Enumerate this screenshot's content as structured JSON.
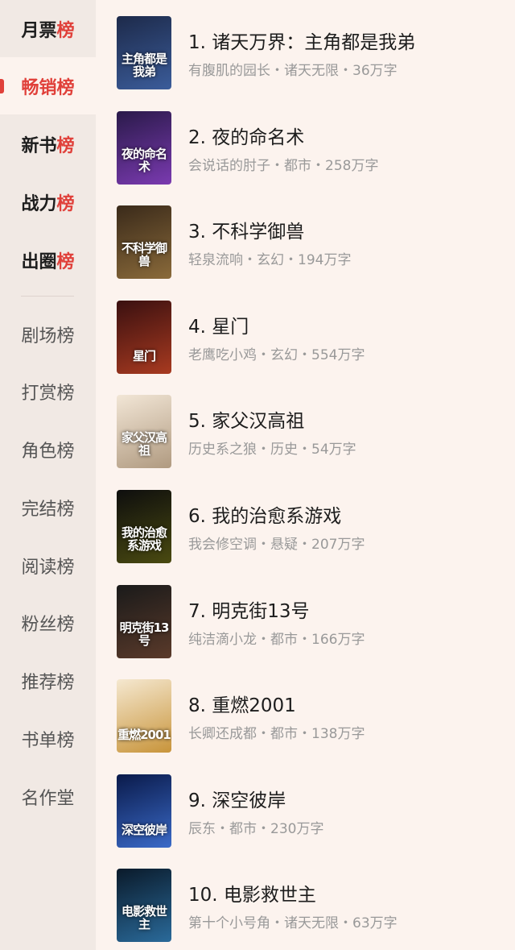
{
  "sidebar": {
    "items": [
      {
        "lo": "月票",
        "hi": "榜"
      },
      {
        "lo": "畅销",
        "hi": "榜"
      },
      {
        "lo": "新书",
        "hi": "榜"
      },
      {
        "lo": "战力",
        "hi": "榜"
      },
      {
        "lo": "出圈",
        "hi": "榜"
      },
      {
        "label": "剧场榜"
      },
      {
        "label": "打赏榜"
      },
      {
        "label": "角色榜"
      },
      {
        "label": "完结榜"
      },
      {
        "label": "阅读榜"
      },
      {
        "label": "粉丝榜"
      },
      {
        "label": "推荐榜"
      },
      {
        "label": "书单榜"
      },
      {
        "label": "名作堂"
      }
    ],
    "active_index": 1
  },
  "books": [
    {
      "title": "1. 诸天万界：主角都是我弟",
      "meta": "有腹肌的园长・诸天无限・36万字",
      "cover_text": "主角都是我弟",
      "cover_colors": [
        "#1d2a4a",
        "#3b5c9a"
      ]
    },
    {
      "title": "2. 夜的命名术",
      "meta": "会说话的肘子・都市・258万字",
      "cover_text": "夜的命名术",
      "cover_colors": [
        "#2a1a4a",
        "#7a3ab0"
      ]
    },
    {
      "title": "3. 不科学御兽",
      "meta": "轻泉流响・玄幻・194万字",
      "cover_text": "不科学御兽",
      "cover_colors": [
        "#3a2a1a",
        "#8a6a3a"
      ]
    },
    {
      "title": "4. 星门",
      "meta": "老鹰吃小鸡・玄幻・554万字",
      "cover_text": "星门",
      "cover_colors": [
        "#3a1010",
        "#a83a20"
      ]
    },
    {
      "title": "5. 家父汉高祖",
      "meta": "历史系之狼・历史・54万字",
      "cover_text": "家父汉高祖",
      "cover_colors": [
        "#f2e6d6",
        "#b09a80"
      ]
    },
    {
      "title": "6. 我的治愈系游戏",
      "meta": "我会修空调・悬疑・207万字",
      "cover_text": "我的治愈系游戏",
      "cover_colors": [
        "#0e0e0e",
        "#4a4a10"
      ]
    },
    {
      "title": "7. 明克街13号",
      "meta": "纯洁滴小龙・都市・166万字",
      "cover_text": "明克街13号",
      "cover_colors": [
        "#1a1a1a",
        "#5a3a2a"
      ]
    },
    {
      "title": "8. 重燃2001",
      "meta": "长卿还成都・都市・138万字",
      "cover_text": "重燃2001",
      "cover_colors": [
        "#f5e8d0",
        "#c8943a"
      ]
    },
    {
      "title": "9. 深空彼岸",
      "meta": "辰东・都市・230万字",
      "cover_text": "深空彼岸",
      "cover_colors": [
        "#0a1a4a",
        "#3a6ac8"
      ]
    },
    {
      "title": "10. 电影救世主",
      "meta": "第十个小号角・诸天无限・63万字",
      "cover_text": "电影救世主",
      "cover_colors": [
        "#0a1a2a",
        "#2a6a9a"
      ]
    }
  ]
}
